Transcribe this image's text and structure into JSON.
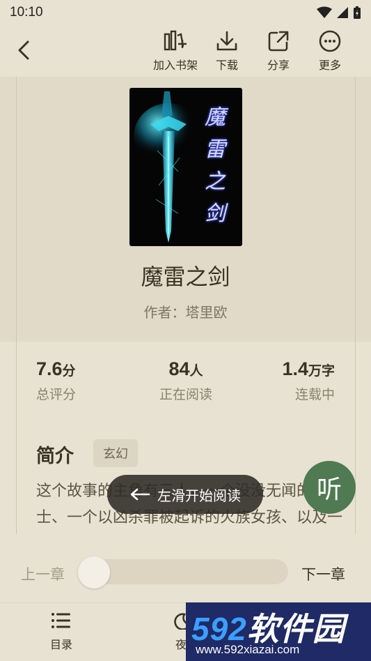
{
  "status_bar": {
    "time": "10:10"
  },
  "toolbar": {
    "add_shelf_label": "加入书架",
    "download_label": "下载",
    "share_label": "分享",
    "more_label": "更多"
  },
  "book": {
    "cover_title": "魔雷之剑",
    "title": "魔雷之剑",
    "author": "作者：塔里欧"
  },
  "stats": [
    {
      "value": "7.6",
      "unit": "分",
      "caption": "总评分"
    },
    {
      "value": "84",
      "unit": "人",
      "caption": "正在阅读"
    },
    {
      "value": "1.4",
      "unit": "万字",
      "caption": "连载中"
    }
  ],
  "intro": {
    "heading": "简介",
    "tag": "玄幻",
    "text": "这个故事的主角有三人，一个没没无闻的骑士、一个以凶杀罪被起诉的火族女孩、以及一名追求真相的年轻牧徒……"
  },
  "listen_label": "听",
  "toast": {
    "text": "左滑开始阅读"
  },
  "chapter_nav": {
    "prev_label": "上一章",
    "next_label": "下一章",
    "progress": 0
  },
  "bottom_nav": {
    "toc_label": "目录",
    "night_label": "夜"
  },
  "watermark": {
    "brand_digits": "592",
    "brand_text": "软件园",
    "url": "www.592xiazai.com"
  },
  "colors": {
    "background": "#e8e2d2",
    "header_bg": "#e1dac8",
    "accent_green": "#4f7a52",
    "text": "#3b3226"
  }
}
